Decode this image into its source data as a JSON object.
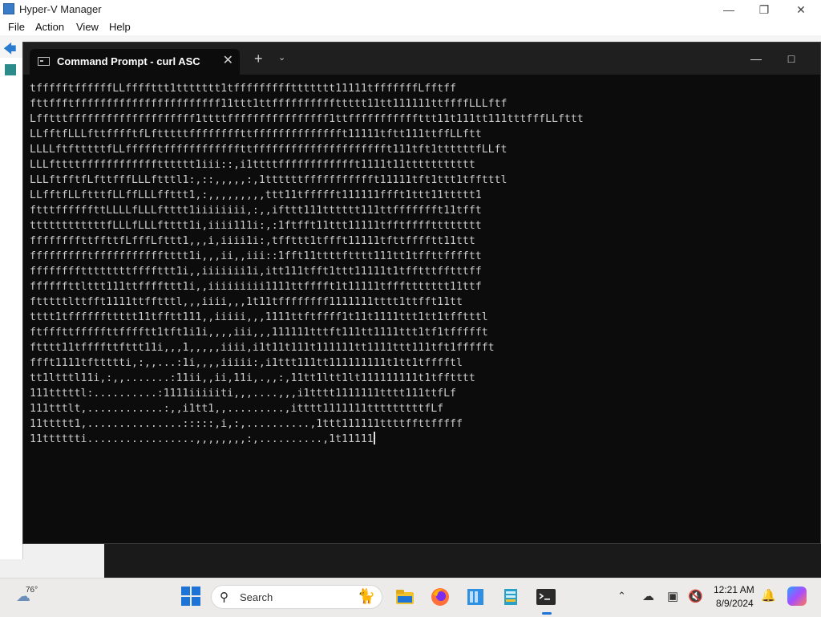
{
  "hyperv": {
    "title": "Hyper-V Manager",
    "menu": [
      "File",
      "Action",
      "View",
      "Help"
    ]
  },
  "terminal": {
    "tab_title": "Command Prompt - curl  ASC",
    "output_lines": [
      "tffffftffffffLLffffttt1ttttttt1tfffffffffttttttt11111tfffffffLfftff",
      "fttffftfffffffffffffffffffffff11ttt1ttffffffffffttttt11tt111111ttffffLLLftf",
      "Lfftttffffffffffffffffffff1ttttffffffffffffffff1ttfffffffffffttt11t111tt111tttfffLLfttt",
      "LLfftfLLLfttfffftfLftttttffffffffttfffffffffffffft11111tftt111ttffLLftt",
      "LLLLftftttttfLLffffftffffffffffffttffffffffffffffffffffft111tft1ttttttfLLft",
      "LLLfttttfffffffffffftttttt1iii::,i1ttttfffffffffffft1111t11ttttttttttt",
      "LLLftfftfLfttfffLLLftttl1:,::,,,,,:,1ttttttffffffffffft11111tft1ttt1tfftttl",
      "LLfftfLLftttfLLffLLLffttt1,:,,,,,,,,,ttt11tffffft111111ffft1ttt11ttttt1",
      "ftttffffffttLLLLfLLLftttt1iiiiiiii,:,,ifttt111tttttt111ttffffffft11tfft",
      "ttttttttttttfLLLfLLLftttt1i,iiii111i:,:1ftfft11ttt11111tfftfffftttttttt",
      "ffffffffttffttfLfffLfttt1,,,i,iiii1i:,tffttt1tffft11111tfttfffftt11ttt",
      "ffffffffftffffffffffftttt1i,,,ii,,iii::1fft11ttttftttt111tt1tffttfffftt",
      "ffffffffttttttttffffttt1i,,iiiiiii1i,itt111tfft1ttt11111t1tfftttfftttff",
      "ffffffttlttt111ttffffttt1i,,iiiiiiiii1111ttfffft1t11111tfffttttttt11ttf",
      "ftttttlttfft1111ttfftttl,,,iiii,,,1t11tffffffff1111111tttt1ttfft11tt",
      "tttt1tffffffttttt11tfftt111,,iiiii,,,1111ttftffff1t11t1111ttt1tt1tfftttl",
      "ftfffttfffffttfffftt1tft1i1i,,,,iii,,,111111tttft111tt1111ttt1tf1tffffft",
      "ftttt11tffffttfttt11i,,,1,,,,,iiii,i1t11t111t111111tt1111ttt111tft1ffffft",
      "ffft1111tfttttti,:,,...:1i,,,,iiiii:,i1ttt111tt111111111t1tt1tfffftl",
      "tt1ltttl11i,:,,.......:11ii,,ii,11i,.,,:,11tt1ltt1lt111111111t1tfftttt",
      "111tttttl:..........:1111iiiiiti,,,....,,,i1tttt1111111tttt111ttfLf",
      "111tttlt,............:,,i1tt1,,.........,itttt1111111tttttttttfLf",
      "11ttttt1,...............:::::,i,:,..........,1ttt111111ttttffttfffff",
      "11tttttti.................,,,,,,,,:,..........,1t11111"
    ]
  },
  "taskbar": {
    "weather_temp": "76°",
    "search_placeholder": "Search",
    "time": "12:21 AM",
    "date": "8/9/2024"
  }
}
